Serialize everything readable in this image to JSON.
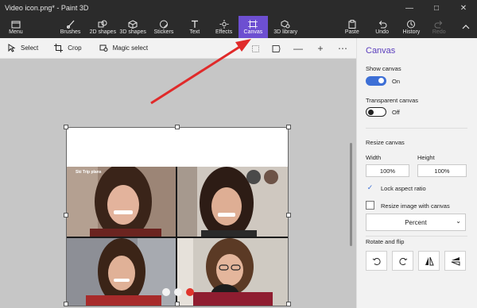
{
  "window": {
    "title": "Video icon.png* - Paint 3D"
  },
  "ribbon": {
    "menu": "Menu",
    "tools": [
      "Brushes",
      "2D shapes",
      "3D shapes",
      "Stickers",
      "Text",
      "Effects",
      "Canvas",
      "3D library"
    ],
    "actions": [
      "Paste",
      "Undo",
      "History",
      "Redo"
    ]
  },
  "toolbar": {
    "select": "Select",
    "crop": "Crop",
    "magic_select": "Magic select"
  },
  "canvas_image": {
    "meeting_title": "Ski Trip plans"
  },
  "panel": {
    "title": "Canvas",
    "show_canvas": {
      "label": "Show canvas",
      "state": "On"
    },
    "transparent_canvas": {
      "label": "Transparent canvas",
      "state": "Off"
    },
    "resize_canvas": "Resize canvas",
    "width_label": "Width",
    "height_label": "Height",
    "width_value": "100%",
    "height_value": "100%",
    "lock_aspect": "Lock aspect ratio",
    "resize_image": "Resize image with canvas",
    "unit": "Percent",
    "rotate_flip": "Rotate and flip"
  },
  "colors": {
    "accent": "#6d4fd1",
    "panel_title": "#5a3dbd",
    "toggle_on": "#3d6fd6",
    "arrow": "#e02a2a"
  }
}
